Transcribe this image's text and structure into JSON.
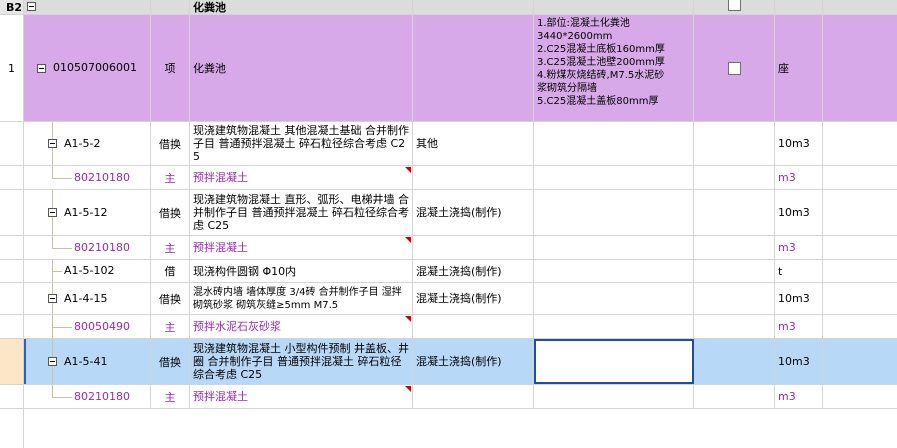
{
  "header_row": {
    "row_label": "B2",
    "name": "化粪池"
  },
  "main_item": {
    "row_no": "1",
    "code": "010507006001",
    "type": "项",
    "name": "化粪池",
    "features": [
      "1.部位:混凝土化粪池",
      "3440*2600mm",
      "2.C25混凝土底板160mm厚",
      "3.C25混凝土池壁200mm厚",
      "4.粉煤灰烧结砖,M7.5水泥砂",
      "浆砌筑分隔墙",
      "5.C25混凝土盖板80mm厚"
    ],
    "unit": "座"
  },
  "rows": [
    {
      "code": "A1-5-2",
      "type": "借换",
      "name": "现浇建筑物混凝土 其他混凝土基础 合并制作子目 普通预拌混凝土 碎石粒径综合考虑 C25",
      "specialty": "其他",
      "unit": "10m3"
    },
    {
      "code": "80210180",
      "type": "主",
      "name": "预拌混凝土",
      "specialty": "",
      "unit": "m3"
    },
    {
      "code": "A1-5-12",
      "type": "借换",
      "name": "现浇建筑物混凝土 直形、弧形、电梯井墙 合并制作子目 普通预拌混凝土 碎石粒径综合考虑 C25",
      "specialty": "混凝土浇捣(制作)",
      "unit": "10m3"
    },
    {
      "code": "80210180",
      "type": "主",
      "name": "预拌混凝土",
      "specialty": "",
      "unit": "m3"
    },
    {
      "code": "A1-5-102",
      "type": "借",
      "name": "现浇构件圆钢 Φ10内",
      "specialty": "混凝土浇捣(制作)",
      "unit": "t"
    },
    {
      "code": "A1-4-15",
      "type": "借换",
      "name": "混水砖内墙 墙体厚度 3/4砖 合并制作子目 湿拌砌筑砂浆 砌筑灰缝≥5mm M7.5",
      "specialty": "混凝土浇捣(制作)",
      "unit": "10m3"
    },
    {
      "code": "80050490",
      "type": "主",
      "name": "预拌水泥石灰砂浆",
      "specialty": "",
      "unit": "m3"
    },
    {
      "code": "A1-5-41",
      "type": "借换",
      "name": "现浇建筑物混凝土 小型构件预制 井盖板、井圈 合并制作子目 普通预拌混凝土 碎石粒径综合考虑 C25",
      "specialty": "混凝土浇捣(制作)",
      "unit": "10m3"
    },
    {
      "code": "80210180",
      "type": "主",
      "name": "预拌混凝土",
      "specialty": "",
      "unit": "m3"
    }
  ],
  "colors": {
    "main_row_bg": "#d8a9e8",
    "selected_row_bg": "#b8d8f8",
    "sub_text": "#9a2aa8",
    "header_bg": "#dcdcdc"
  }
}
